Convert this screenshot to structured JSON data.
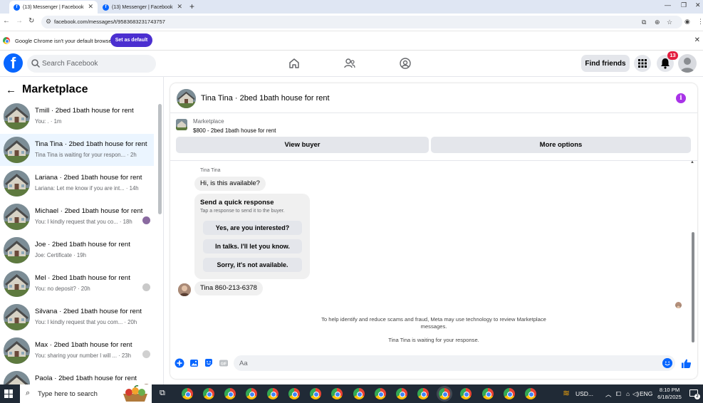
{
  "browser": {
    "tabs": [
      {
        "label": "(13) Messenger | Facebook",
        "active": true
      },
      {
        "label": "(13) Messenger | Facebook",
        "active": false
      }
    ],
    "url": "facebook.com/messages/t/9583683231743757",
    "infobar": {
      "message": "Google Chrome isn't your default browser",
      "button": "Set as default"
    }
  },
  "fb_header": {
    "logo": "f",
    "search_placeholder": "Search Facebook",
    "find_friends": "Find friends",
    "notification_count": "13"
  },
  "sidebar": {
    "title": "Marketplace",
    "conversations": [
      {
        "name": "Tmill · 2bed 1bath house for rent",
        "preview": "You: . · 1m",
        "active": false
      },
      {
        "name": "Tina Tina · 2bed 1bath house for rent",
        "preview": "Tina Tina is waiting for your respon... · 2h",
        "active": true
      },
      {
        "name": "Lariana · 2bed 1bath house for rent",
        "preview": "Lariana: Let me know if you are int... · 14h",
        "active": false
      },
      {
        "name": "Michael · 2bed 1bath house for rent",
        "preview": "You: I kindly request that you co... · 18h",
        "active": false
      },
      {
        "name": "Joe · 2bed 1bath house for rent",
        "preview": "Joe: Certificate · 19h",
        "active": false
      },
      {
        "name": "Mel · 2bed 1bath house for rent",
        "preview": "You: no deposit? · 20h",
        "active": false
      },
      {
        "name": "Silvana · 2bed 1bath house for rent",
        "preview": "You: I kindly request that you com... · 20h",
        "active": false
      },
      {
        "name": "Max · 2bed 1bath house for rent",
        "preview": "You: sharing your number I will ... · 23h",
        "active": false
      },
      {
        "name": "Paola · 2bed 1bath house for rent",
        "preview": "",
        "active": false
      }
    ]
  },
  "chat": {
    "title": "Tina Tina · 2bed 1bath house for rent",
    "listing_source": "Marketplace",
    "listing_title": "$800 - 2bed 1bath house for rent",
    "view_buyer": "View buyer",
    "more_options": "More options",
    "sender": "Tina Tina",
    "first_message": "Hi, is this available?",
    "quick_title": "Send a quick response",
    "quick_subtitle": "Tap a response to send it to the buyer.",
    "quick_options": [
      "Yes, are you interested?",
      "In talks. I'll let you know.",
      "Sorry, it's not available."
    ],
    "second_message": "Tina 860-213-6378",
    "notice": "To help identify and reduce scams and fraud, Meta may use technology to review Marketplace messages.",
    "waiting": "Tina Tina is waiting for your response.",
    "composer_placeholder": "Aa"
  },
  "taskbar": {
    "search_text": "Type here to search",
    "currency": "USD...",
    "lang": "ENG",
    "time": "8:10 PM",
    "date": "6/18/2025",
    "notif_count": "2"
  },
  "colors": {
    "fb_blue": "#0866ff",
    "active_row": "#ebf5ff",
    "badge_red": "#e41e3f",
    "info_purple": "#a933e8",
    "set_default": "#4b2fd0"
  }
}
